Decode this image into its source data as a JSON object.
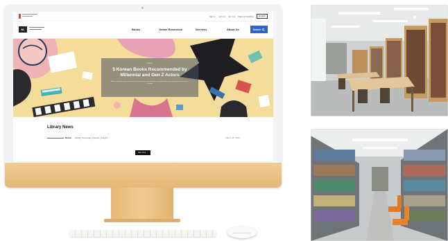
{
  "site": {
    "utility_links": [
      "Sign in",
      "Join Us",
      "Join Us",
      "Plans & Invitation"
    ],
    "language": "English",
    "brand_mark": "NL",
    "nav": [
      "Books",
      "Online Resources",
      "Services",
      "About Us"
    ],
    "search_label": "Search"
  },
  "hero": {
    "eyebrow": "Issue",
    "title": "5 Korean Books Recommended by Millennial and Gen Z Actors",
    "subtitle": "Actors and artists share a curated list of novels they say are worth every page and every rereading and much more of every"
  },
  "news": {
    "heading": "Library News",
    "items": [
      {
        "category": "Notice",
        "text": "Library Temporary Closure ( 6 April )",
        "date": "March 15, 2022"
      }
    ],
    "see_more": "See more"
  },
  "colors": {
    "accent_blue": "#2f63c7",
    "hero_bg": "#f4dd9a",
    "news_accent": "#d0384a",
    "monitor_gold": "#e9bd7e"
  }
}
